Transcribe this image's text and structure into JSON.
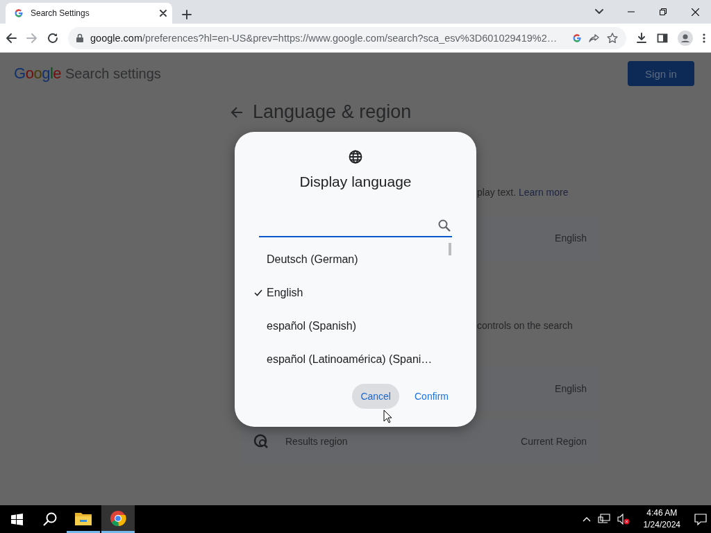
{
  "browser": {
    "tab": {
      "title": "Search Settings"
    },
    "address": {
      "domain": "google.com",
      "path": "/preferences?hl=en-US&prev=https://www.google.com/search?sca_esv%3D601029419%2…"
    }
  },
  "page": {
    "logo": "Google",
    "title": "Search settings",
    "sign_in": "Sign in",
    "heading": "Language & region",
    "items": [
      {
        "kind": "description",
        "text": "play text.",
        "link": "Learn more"
      },
      {
        "kind": "setting",
        "value": "English"
      },
      {
        "kind": "description",
        "text": "controls on the search"
      },
      {
        "kind": "setting",
        "value": "English"
      },
      {
        "kind": "setting",
        "label": "Results region",
        "value": "Current Region"
      }
    ]
  },
  "dialog": {
    "title": "Display language",
    "languages": [
      {
        "label": "Deutsch  (German)",
        "selected": false
      },
      {
        "label": "English",
        "selected": true
      },
      {
        "label": "español  (Spanish)",
        "selected": false
      },
      {
        "label": "español (Latinoamérica)  (Spani…",
        "selected": false
      }
    ],
    "buttons": [
      {
        "label": "Cancel",
        "hovered": true
      },
      {
        "label": "Confirm",
        "hovered": false
      }
    ]
  },
  "taskbar": {
    "apps": [
      {
        "kind": "explorer",
        "active": false
      },
      {
        "kind": "chrome",
        "active": true
      }
    ],
    "time": "4:46 AM",
    "date": "1/24/2024"
  }
}
